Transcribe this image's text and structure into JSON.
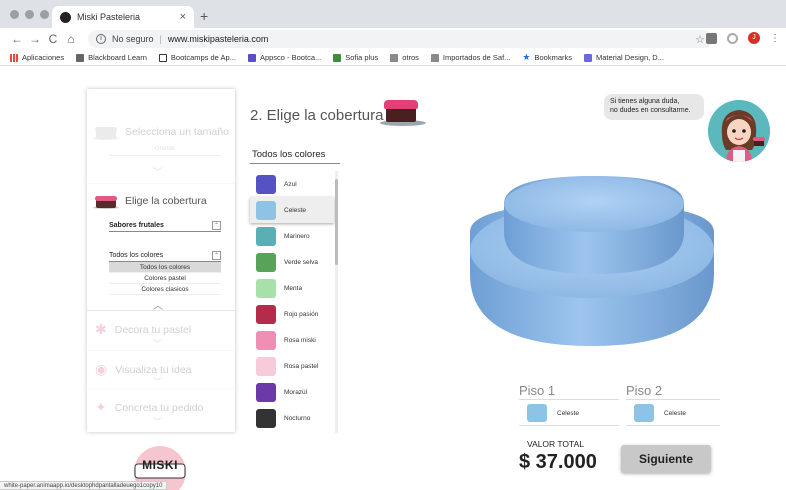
{
  "browser": {
    "tab_title": "Miski Pasteleria",
    "tab_close": "×",
    "new_tab": "+",
    "nav": {
      "back": "←",
      "forward": "→",
      "reload": "C",
      "home": "⌂"
    },
    "security": "No seguro",
    "url": "www.miskipasteleria.com",
    "star": "☆",
    "profile_initial": "J",
    "menu": "⋮",
    "bookmarks": [
      {
        "label": "Aplicaciones",
        "icon": "apps-grid-icon"
      },
      {
        "label": "Blackboard Learn",
        "icon": "blackboard-icon"
      },
      {
        "label": "Bootcamps de Ap...",
        "icon": "bootcamp-icon"
      },
      {
        "label": "Appsco - Bootca...",
        "icon": "appsco-icon"
      },
      {
        "label": "Sofia plus",
        "icon": "sofia-icon"
      },
      {
        "label": "otros",
        "icon": "folder-icon"
      },
      {
        "label": "Importados de Saf...",
        "icon": "folder-icon"
      },
      {
        "label": "Bookmarks",
        "icon": "star-icon"
      },
      {
        "label": "Material Design, D...",
        "icon": "material-icon"
      }
    ]
  },
  "steps": {
    "size": {
      "title": "Selecciona un tamaño",
      "sub": "Grande"
    },
    "topping": {
      "title": "Elige la cobertura",
      "flavor_select": "Sabores frutales",
      "color_select": "Todos los colores",
      "options": [
        "Todos los colores",
        "Colores pastel",
        "Colores clasicos"
      ],
      "collapse": "︿"
    },
    "decorate": {
      "title": "Decora tu pastel"
    },
    "visualize": {
      "title": "Visualiza tu idea"
    },
    "order": {
      "title": "Concreta tu pedido"
    },
    "chevron": "﹀"
  },
  "main": {
    "section_title": "2. Elige la cobertura",
    "filter_label": "Todos los colores",
    "colors": [
      {
        "name": "Azul",
        "hex": "#5552c6",
        "active": false
      },
      {
        "name": "Celeste",
        "hex": "#8ec3e6",
        "active": true
      },
      {
        "name": "Marinero",
        "hex": "#5aafb4",
        "active": false
      },
      {
        "name": "Verde selva",
        "hex": "#58a35a",
        "active": false
      },
      {
        "name": "Menta",
        "hex": "#a8e0aa",
        "active": false
      },
      {
        "name": "Rojo pasión",
        "hex": "#b32d4a",
        "active": false
      },
      {
        "name": "Rosa miski",
        "hex": "#f08fb4",
        "active": false
      },
      {
        "name": "Rosa pastel",
        "hex": "#f7cbd9",
        "active": false
      },
      {
        "name": "Morazúl",
        "hex": "#6b3aa8",
        "active": false
      },
      {
        "name": "Nocturno",
        "hex": "#333333",
        "active": false
      }
    ]
  },
  "help": {
    "line1": "Si tienes alguna duda,",
    "line2": "no dudes en consultarme."
  },
  "floors": [
    {
      "label": "Piso 1",
      "color_name": "Celeste",
      "hex": "#8ec3e6"
    },
    {
      "label": "Piso 2",
      "color_name": "Celeste",
      "hex": "#8ec3e6"
    }
  ],
  "total": {
    "label": "VALOR TOTAL",
    "value": "$ 37.000"
  },
  "next_button": "Siguiente",
  "logo_text": "MISKI",
  "status_url": "white-paper.animaapp.io/desktophdpantalladeuego1copy10"
}
